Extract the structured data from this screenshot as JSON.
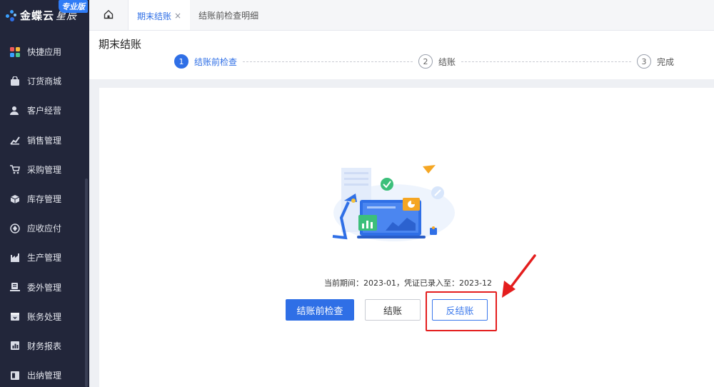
{
  "sidebar": {
    "logo_text": "金蝶云",
    "logo_sub": "星辰",
    "badge": "专业版",
    "items": [
      {
        "label": "快捷应用",
        "icon": "grid-icon"
      },
      {
        "label": "订货商城",
        "icon": "bag-icon"
      },
      {
        "label": "客户经营",
        "icon": "user-icon"
      },
      {
        "label": "销售管理",
        "icon": "chart-up-icon"
      },
      {
        "label": "采购管理",
        "icon": "cart-icon"
      },
      {
        "label": "库存管理",
        "icon": "box-icon"
      },
      {
        "label": "应收应付",
        "icon": "diamond-icon"
      },
      {
        "label": "生产管理",
        "icon": "factory-icon"
      },
      {
        "label": "委外管理",
        "icon": "truck-icon"
      },
      {
        "label": "账务处理",
        "icon": "ledger-icon"
      },
      {
        "label": "财务报表",
        "icon": "report-icon"
      },
      {
        "label": "出纳管理",
        "icon": "cash-icon"
      }
    ]
  },
  "tabs": {
    "home_icon": "home-icon",
    "items": [
      {
        "label": "期末结账",
        "active": true,
        "closable": true
      },
      {
        "label": "结账前检查明细",
        "active": false,
        "closable": false
      }
    ],
    "close_glyph": "×"
  },
  "header": {
    "title": "期末结账",
    "steps": [
      {
        "num": "1",
        "label": "结账前检查",
        "active": true
      },
      {
        "num": "2",
        "label": "结账",
        "active": false
      },
      {
        "num": "3",
        "label": "完成",
        "active": false
      }
    ]
  },
  "main": {
    "period_text": "当前期间：2023-01，凭证已录入至：2023-12",
    "buttons": {
      "check": "结账前检查",
      "close": "结账",
      "reverse": "反结账"
    }
  },
  "colors": {
    "sidebar_bg": "#22263a",
    "primary": "#2f6fe6",
    "highlight": "#e41d1d"
  }
}
